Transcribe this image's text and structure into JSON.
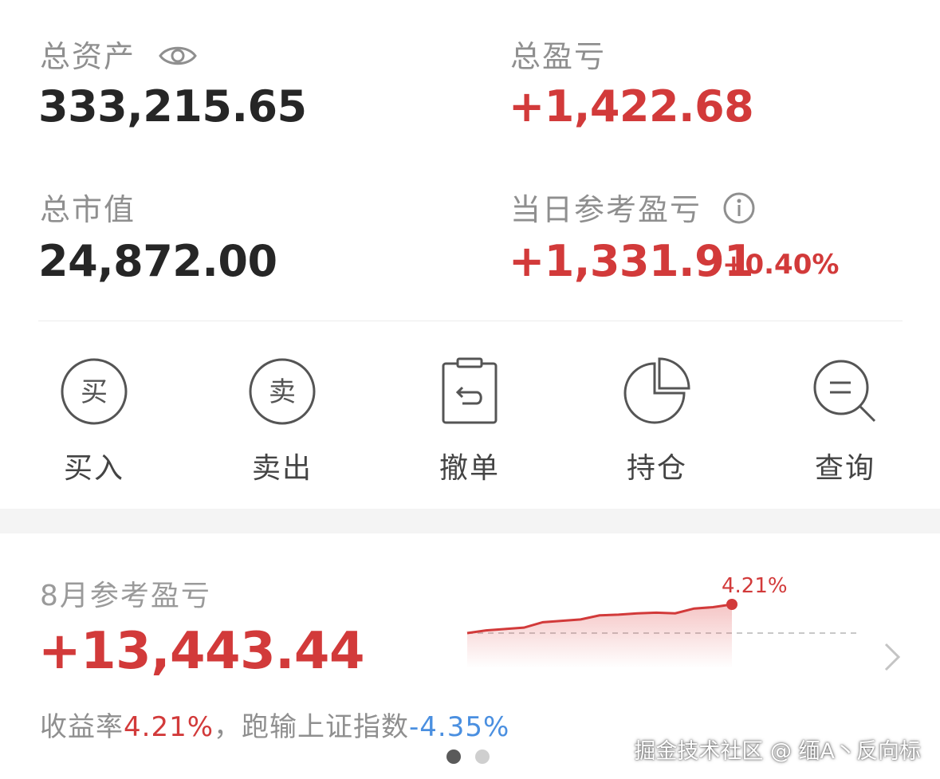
{
  "summary": {
    "total_assets_label": "总资产",
    "total_assets_value": "333,215.65",
    "total_pnl_label": "总盈亏",
    "total_pnl_value": "+1,422.68",
    "market_value_label": "总市值",
    "market_value_value": "24,872.00",
    "daily_pnl_label": "当日参考盈亏",
    "daily_pnl_value": "+1,331.91",
    "daily_pnl_pct": "+0.40%"
  },
  "actions": [
    {
      "label": "买入",
      "glyph": "买",
      "icon": "buy-icon"
    },
    {
      "label": "卖出",
      "glyph": "卖",
      "icon": "sell-icon"
    },
    {
      "label": "撤单",
      "icon": "cancel-order-icon"
    },
    {
      "label": "持仓",
      "icon": "pie-chart-icon"
    },
    {
      "label": "查询",
      "icon": "search-icon"
    }
  ],
  "monthly": {
    "title": "8月参考盈亏",
    "value": "+13,443.44",
    "return_label": "收益率",
    "return_value": "4.21%",
    "comma": "，",
    "benchmark_label": "跑输上证指数",
    "benchmark_value": "-4.35%"
  },
  "chart_data": {
    "type": "area",
    "series": [
      {
        "values": [
          0.0,
          0.4,
          0.6,
          0.8,
          1.6,
          1.8,
          2.0,
          2.6,
          2.7,
          2.9,
          3.0,
          2.9,
          3.6,
          3.8,
          4.21
        ]
      }
    ],
    "end_label": "4.21%",
    "ylim": [
      0,
      4.21
    ],
    "baseline": 0
  },
  "pager": {
    "count": 2,
    "active": 0
  },
  "watermark": "掘金技术社区 @ 缅A丶反向标",
  "colors": {
    "red": "#d23a3a",
    "blue": "#4a8fe0",
    "gray_text": "#8f8f8f"
  }
}
